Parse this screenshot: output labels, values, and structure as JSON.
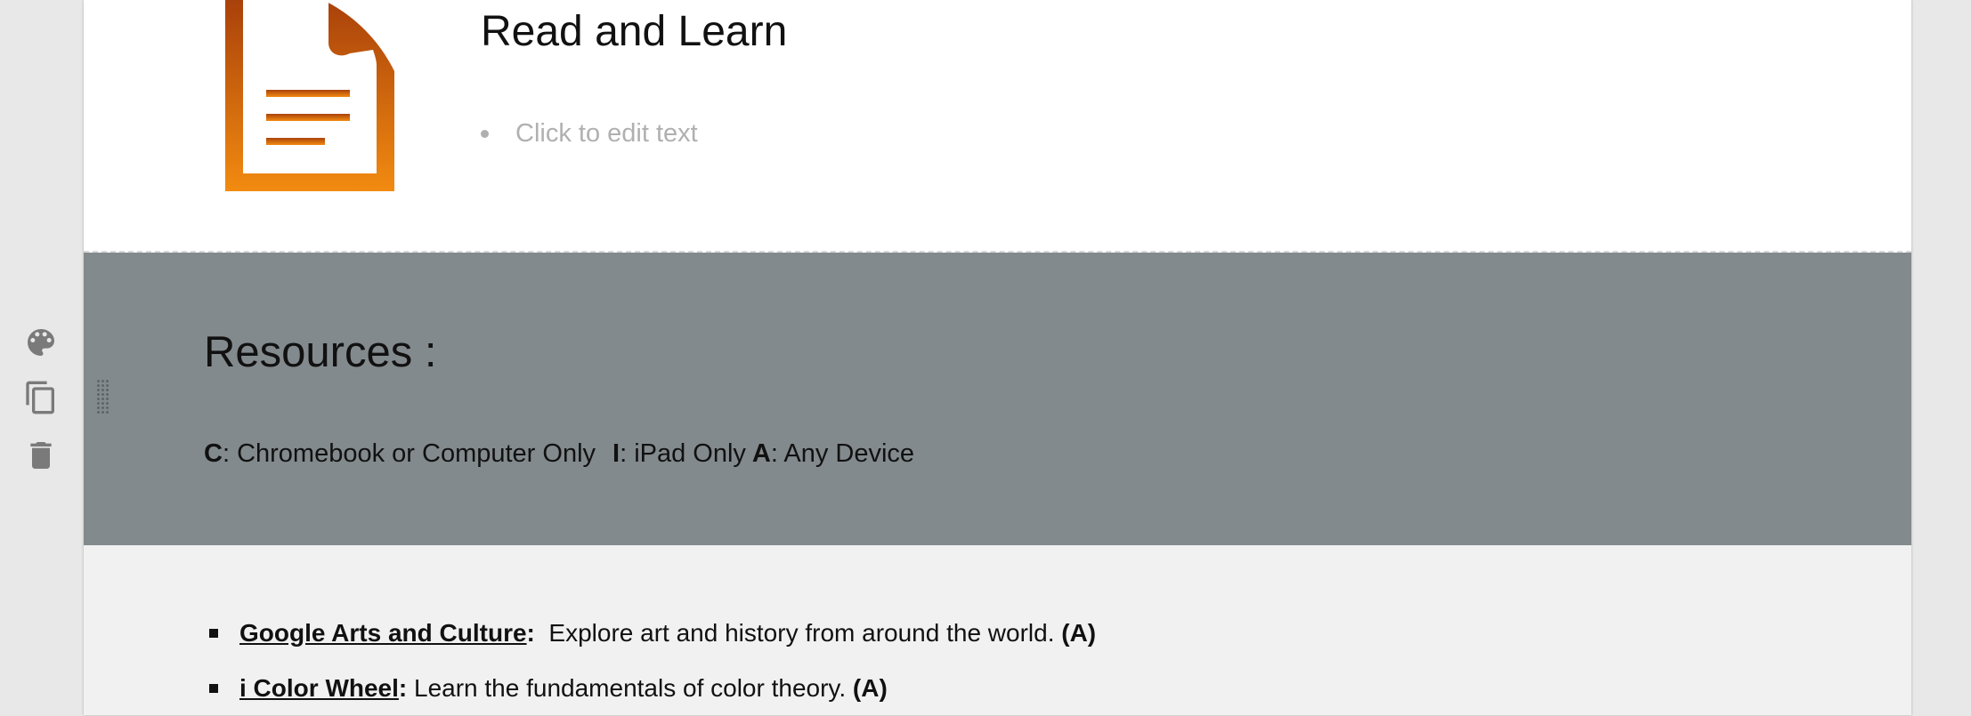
{
  "top_section": {
    "title": "Read and Learn",
    "bullet_placeholder": "Click to edit text",
    "icon": "document-icon"
  },
  "resources_section": {
    "title": "Resources :",
    "legend": [
      {
        "key": "C",
        "text": ": Chromebook or Computer Only"
      },
      {
        "key": "I",
        "text": ": iPad Only"
      },
      {
        "key": "A",
        "text": ": Any Device"
      }
    ]
  },
  "resource_list": [
    {
      "link": "Google Arts and Culture",
      "sep": ":",
      "desc": "  Explore art and history from around the world. ",
      "device": "(A)"
    },
    {
      "link": "i Color Wheel",
      "sep": ":",
      "desc": " Learn the fundamentals of color theory. ",
      "device": "(A)"
    }
  ],
  "toolbar": {
    "icons": [
      "palette-icon",
      "copy-icon",
      "trash-icon"
    ]
  },
  "colors": {
    "icon_orange_top": "#a9410b",
    "icon_orange_bottom": "#f28b10",
    "resources_bg": "#838a8d",
    "list_bg": "#f1f1f1",
    "toolbar_icon": "#7a7a7a"
  }
}
